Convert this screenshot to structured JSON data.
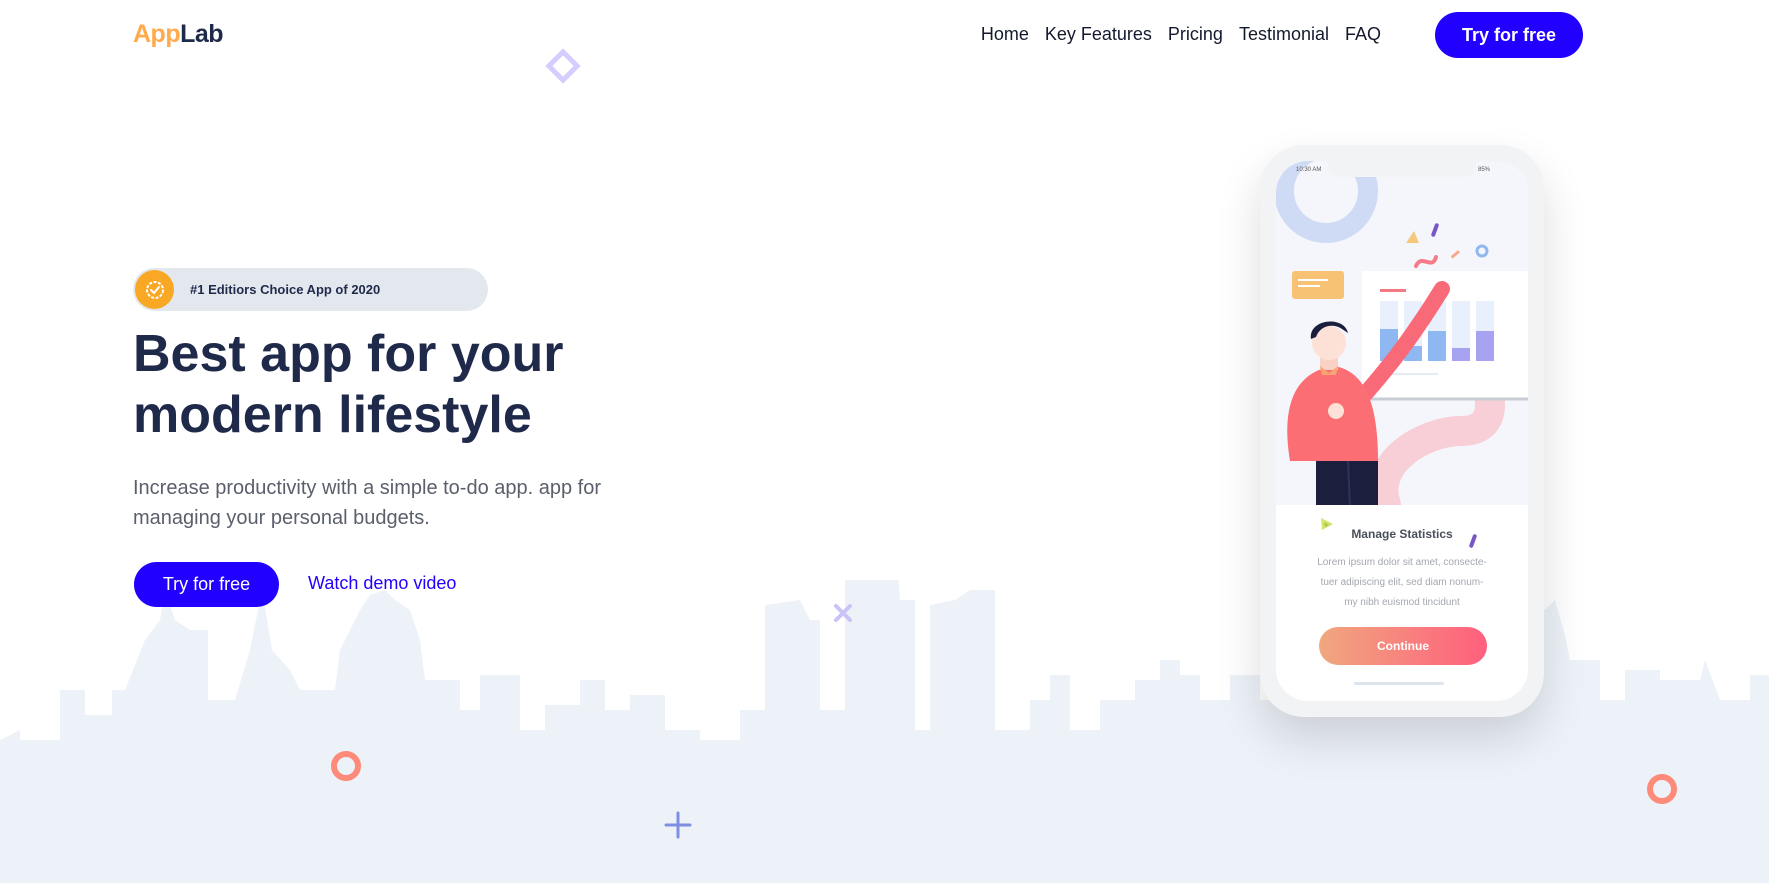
{
  "logo": {
    "part1": "App",
    "part2": "Lab"
  },
  "nav": {
    "items": [
      {
        "label": "Home"
      },
      {
        "label": "Key Features"
      },
      {
        "label": "Pricing"
      },
      {
        "label": "Testimonial"
      },
      {
        "label": "FAQ"
      }
    ],
    "cta_label": "Try for free"
  },
  "hero": {
    "badge_text": "#1 Editiors Choice App of 2020",
    "title_line1": "Best app for your",
    "title_line2": "modern lifestyle",
    "subtitle_line1": "Increase productivity with a simple to-do app. app for",
    "subtitle_line2": "managing your personal budgets.",
    "cta_label": "Try for free",
    "demo_link": "Watch demo video"
  },
  "phone": {
    "status_time": "10:30 AM",
    "status_battery": "85%",
    "card_title": "Manage Statistics",
    "card_text_line1": "Lorem ipsum dolor sit amet, consecte-",
    "card_text_line2": "tuer adipiscing elit, sed diam nonum-",
    "card_text_line3": "my nibh euismod tincidunt",
    "continue_label": "Continue"
  },
  "colors": {
    "accent": "#2100ff",
    "logo_orange": "#ffaa4c",
    "heading": "#1f2a4b",
    "badge_bg": "#e3e8ee",
    "skyline": "#edf2f9",
    "continue_gradient_start": "#f0a77e",
    "continue_gradient_end": "#ff5f7e"
  },
  "icons": {
    "badge": "check-badge-icon",
    "decorations": [
      "diamond-outline-icon",
      "cross-icon",
      "plus-icon",
      "ring-icon"
    ]
  }
}
